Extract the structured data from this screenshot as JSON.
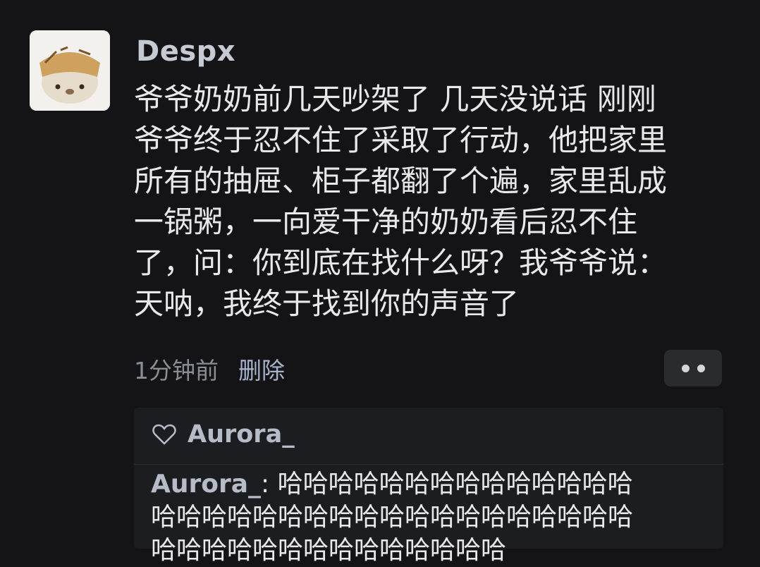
{
  "post": {
    "author": "Despx",
    "lines": [
      "爷爷奶奶前几天吵架了 几天没说话 刚刚",
      "爷爷终于忍不住了采取了行动，他把家里",
      "所有的抽屉、柜子都翻了个遍，家里乱成",
      "一锅粥，一向爱干净的奶奶看后忍不住",
      "了，问：你到底在找什么呀？我爷爷说：",
      "天呐，我终于找到你的声音了"
    ],
    "time": "1分钟前",
    "delete_label": "删除",
    "more_icon": "more-dots-icon"
  },
  "reply": {
    "like_icon": "heart-icon",
    "liker": "Aurora_",
    "author": "Aurora_",
    "separator": ":",
    "lines": [
      "哈哈哈哈哈哈哈哈哈哈哈哈哈哈",
      "哈哈哈哈哈哈哈哈哈哈哈哈哈哈哈哈哈哈哈",
      "哈哈哈哈哈哈哈哈哈哈哈哈哈哈"
    ]
  },
  "colors": {
    "background": "#141416",
    "text": "#e9e9ea",
    "username": "#c5cad3",
    "muted": "#8a8d93",
    "link": "#a8b4cc"
  }
}
